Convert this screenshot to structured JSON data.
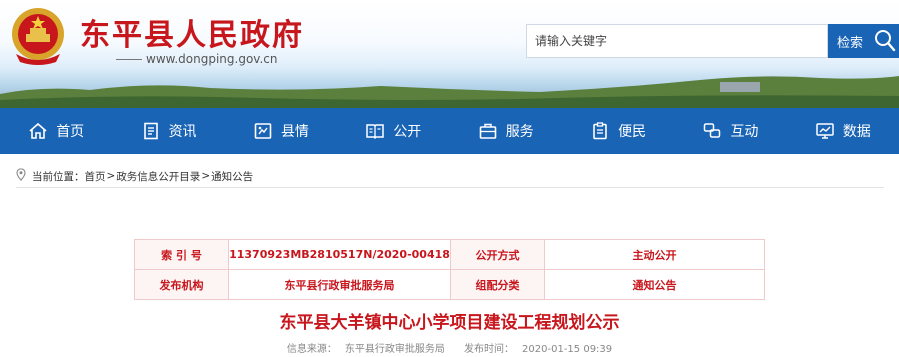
{
  "header": {
    "title": "东平县人民政府",
    "url": "www.dongping.gov.cn"
  },
  "search": {
    "placeholder": "请输入关键字",
    "button_label": "检索"
  },
  "nav": [
    {
      "label": "首页",
      "icon": "home-icon"
    },
    {
      "label": "资讯",
      "icon": "document-icon"
    },
    {
      "label": "县情",
      "icon": "map-icon"
    },
    {
      "label": "公开",
      "icon": "book-icon"
    },
    {
      "label": "服务",
      "icon": "briefcase-icon"
    },
    {
      "label": "便民",
      "icon": "clipboard-icon"
    },
    {
      "label": "互动",
      "icon": "chat-icon"
    },
    {
      "label": "数据",
      "icon": "monitor-chart-icon"
    }
  ],
  "breadcrumb": {
    "prefix": "当前位置：",
    "items": [
      "首页",
      "政务信息公开目录",
      "通知公告"
    ],
    "separator": ">"
  },
  "info_table": {
    "index_label": "索  引  号",
    "index_value": "11370923MB2810517N/2020-00418",
    "method_label": "公开方式",
    "method_value": "主动公开",
    "publisher_label": "发布机构",
    "publisher_value": "东平县行政审批服务局",
    "category_label": "组配分类",
    "category_value": "通知公告"
  },
  "article": {
    "title": "东平县大羊镇中心小学项目建设工程规划公示",
    "source_label": "信息来源：",
    "source_value": "东平县行政审批服务局",
    "time_label": "发布时间：",
    "time_value": "2020-01-15 09:39"
  },
  "colors": {
    "brand_red": "#c8161d",
    "nav_blue": "#1a64b6"
  }
}
